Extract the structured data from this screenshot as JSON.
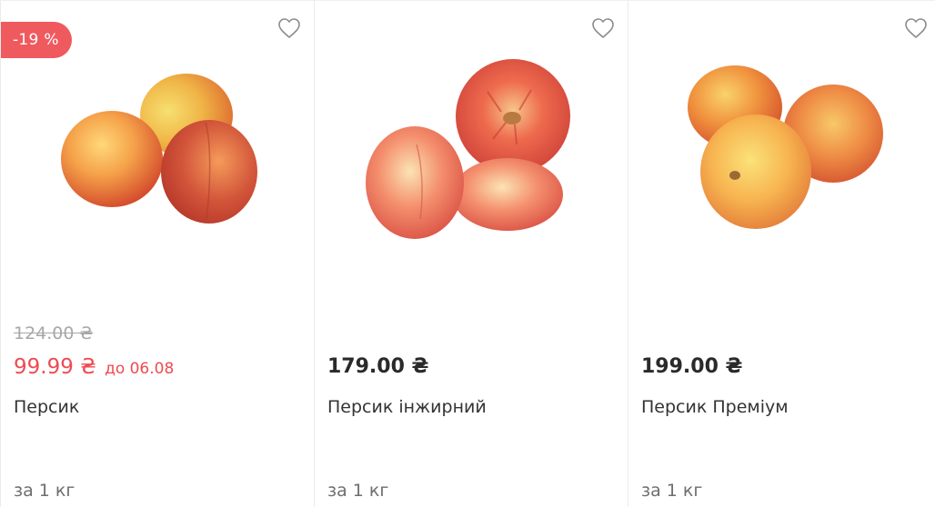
{
  "products": [
    {
      "discount_badge": "-19 %",
      "old_price": "124.00 ₴",
      "price": "99.99 ₴",
      "price_valid_until": "до 06.08",
      "name": "Персик",
      "unit": "за 1 кг",
      "favorite_icon": "heart-outline-icon",
      "image": "peaches"
    },
    {
      "price": "179.00 ₴",
      "name": "Персик інжирний",
      "unit": "за 1 кг",
      "favorite_icon": "heart-outline-icon",
      "image": "flat-peaches"
    },
    {
      "price": "199.00 ₴",
      "name": "Персик Преміум",
      "unit": "за 1 кг",
      "favorite_icon": "heart-outline-icon",
      "image": "peaches"
    }
  ],
  "colors": {
    "sale": "#ee4b51",
    "badge": "#ef5a5f",
    "text": "#2a2a2a",
    "muted": "#a7a7a7"
  }
}
